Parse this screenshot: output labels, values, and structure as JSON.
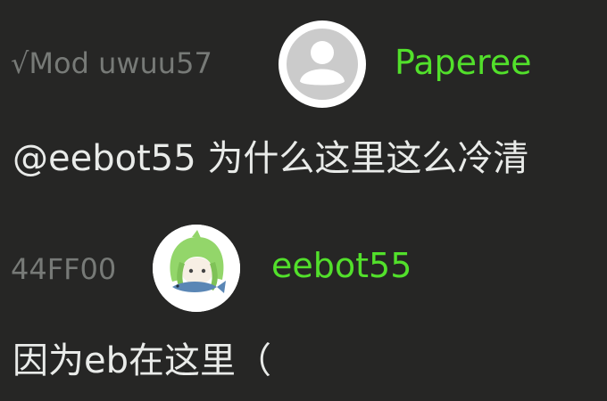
{
  "messages": [
    {
      "meta_text": "√Mod uwuu57",
      "username": "Paperee",
      "text": "@eebot55 为什么这里这么冷清",
      "avatar_icon": "default-user-avatar-icon",
      "username_color": "#52e02b"
    },
    {
      "meta_text": "44FF00",
      "username": "eebot55",
      "text": "因为eb在这里（",
      "avatar_icon": "anime-character-avatar",
      "username_color": "#52e02b"
    }
  ]
}
